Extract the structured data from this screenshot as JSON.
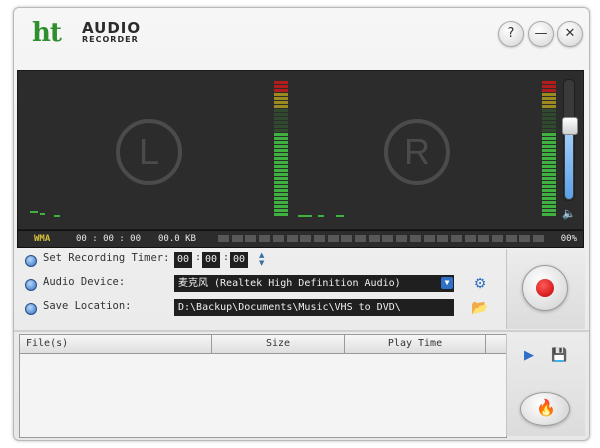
{
  "app": {
    "logo_mark": "ht",
    "logo_line1": "AUDIO",
    "logo_line2": "RECORDER"
  },
  "titlebar_buttons": {
    "help": "?",
    "minimize": "—",
    "close": "✕"
  },
  "channels": {
    "left": "L",
    "right": "R"
  },
  "meters": {
    "left_level": 0.62,
    "right_level": 0.62
  },
  "volume": {
    "level": 0.62,
    "speaker_icon": "speaker-icon"
  },
  "status": {
    "format": "WMA",
    "time": "00 : 00 : 00",
    "size": "00.0 KB",
    "percent": "00%",
    "progress": 0
  },
  "settings": {
    "timer_label": "Set Recording Timer:",
    "timer_h": "00",
    "timer_m": "00",
    "timer_s": "00",
    "device_label": "Audio Device:",
    "device_value": "麦克风 (Realtek High Definition Audio)",
    "location_label": "Save Location:",
    "location_value": "D:\\Backup\\Documents\\Music\\VHS to DVD\\"
  },
  "filelist": {
    "columns": [
      "File(s)",
      "Size",
      "Play Time"
    ]
  },
  "colors": {
    "accent": "#2f6fc8",
    "record": "#d40000",
    "meter_green": "#3fb13f",
    "meter_red": "#b11d1d"
  }
}
